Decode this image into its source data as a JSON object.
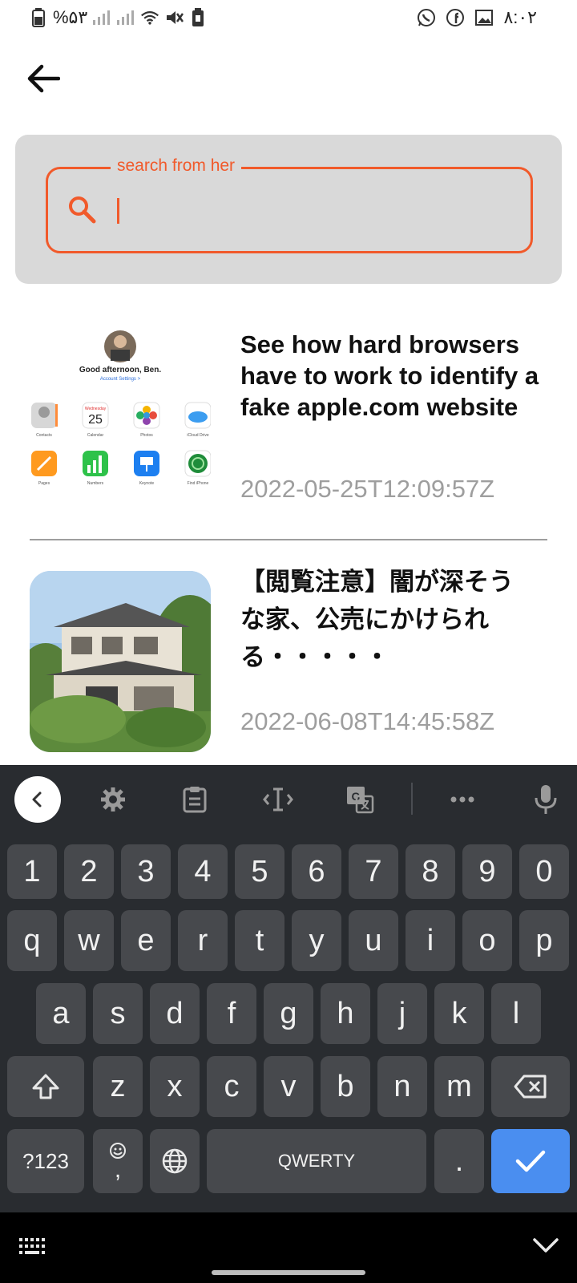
{
  "status_bar": {
    "battery_text": "%۵۳",
    "time": "۸:۰۲"
  },
  "search": {
    "legend": "search from her",
    "value": ""
  },
  "articles": [
    {
      "title": "See how hard browsers have to work to identify a fake apple.com website",
      "date": "2022-05-25T12:09:57Z",
      "thumb": {
        "greeting": "Good afternoon, Ben.",
        "account_link": "Account Settings >",
        "calendar_day": "Wednesday",
        "calendar_date": "25",
        "apps": [
          "Contacts",
          "Calendar",
          "Photos",
          "iCloud Drive",
          "Pages",
          "Numbers",
          "Keynote",
          "Find iPhone"
        ]
      }
    },
    {
      "title": "【閲覧注意】闇が深そうな家、公売にかけられる・・・・・",
      "date": "2022-06-08T14:45:58Z"
    }
  ],
  "keyboard": {
    "number_row": [
      "1",
      "2",
      "3",
      "4",
      "5",
      "6",
      "7",
      "8",
      "9",
      "0"
    ],
    "row1": [
      "q",
      "w",
      "e",
      "r",
      "t",
      "y",
      "u",
      "i",
      "o",
      "p"
    ],
    "row2": [
      "a",
      "s",
      "d",
      "f",
      "g",
      "h",
      "j",
      "k",
      "l"
    ],
    "row3": [
      "z",
      "x",
      "c",
      "v",
      "b",
      "n",
      "m"
    ],
    "symbols_label": "?123",
    "comma_label": ",",
    "space_label": "QWERTY",
    "period_label": ".",
    "accent_color": "#4a8ef0"
  },
  "colors": {
    "accent": "#f15a2b",
    "panel": "#d9d9d9",
    "keyboard_bg": "#292c30",
    "key_bg": "#47494d"
  }
}
